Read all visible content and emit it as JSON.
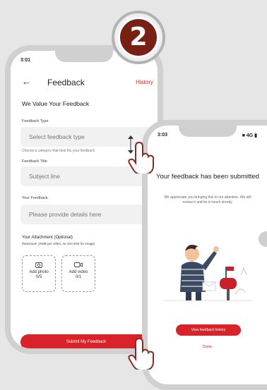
{
  "step": {
    "number": "2"
  },
  "colors": {
    "accent": "#d8232a",
    "badge": "#7a1f16",
    "frame": "#d0d0d0"
  },
  "feedback_screen": {
    "status_time": "3:01",
    "status_icons": "■■ ▮",
    "back_icon": "←",
    "title": "Feedback",
    "history_label": "History",
    "heading": "We Value Your Feedback",
    "type_label": "Feedback Type",
    "type_placeholder": "Select feedback type",
    "type_hint": "Choose a category that best fits your feedback",
    "title_label": "Feedback Title",
    "title_placeholder": "Subject line",
    "body_label": "Your Feedback",
    "body_placeholder": "Please provide details here",
    "attach_label": "Your Attachment (Optional)",
    "attach_sub": "(Maximum 15MB per video, no size limit for image)",
    "add_photo": {
      "icon": "camera-icon",
      "label": "Add photo",
      "count": "0/5"
    },
    "add_video": {
      "icon": "video-icon",
      "label": "Add video",
      "count": "0/1"
    },
    "submit_label": "Submit My Feedback"
  },
  "success_screen": {
    "status_time": "3:03",
    "status_icons": "■ 4G ▮",
    "heading": "Your feedback has been submitted",
    "description": "We appreciate you bringing this to our attention. We will review it and be in touch shortly.",
    "view_history_label": "View feedback history",
    "done_label": "Done"
  }
}
